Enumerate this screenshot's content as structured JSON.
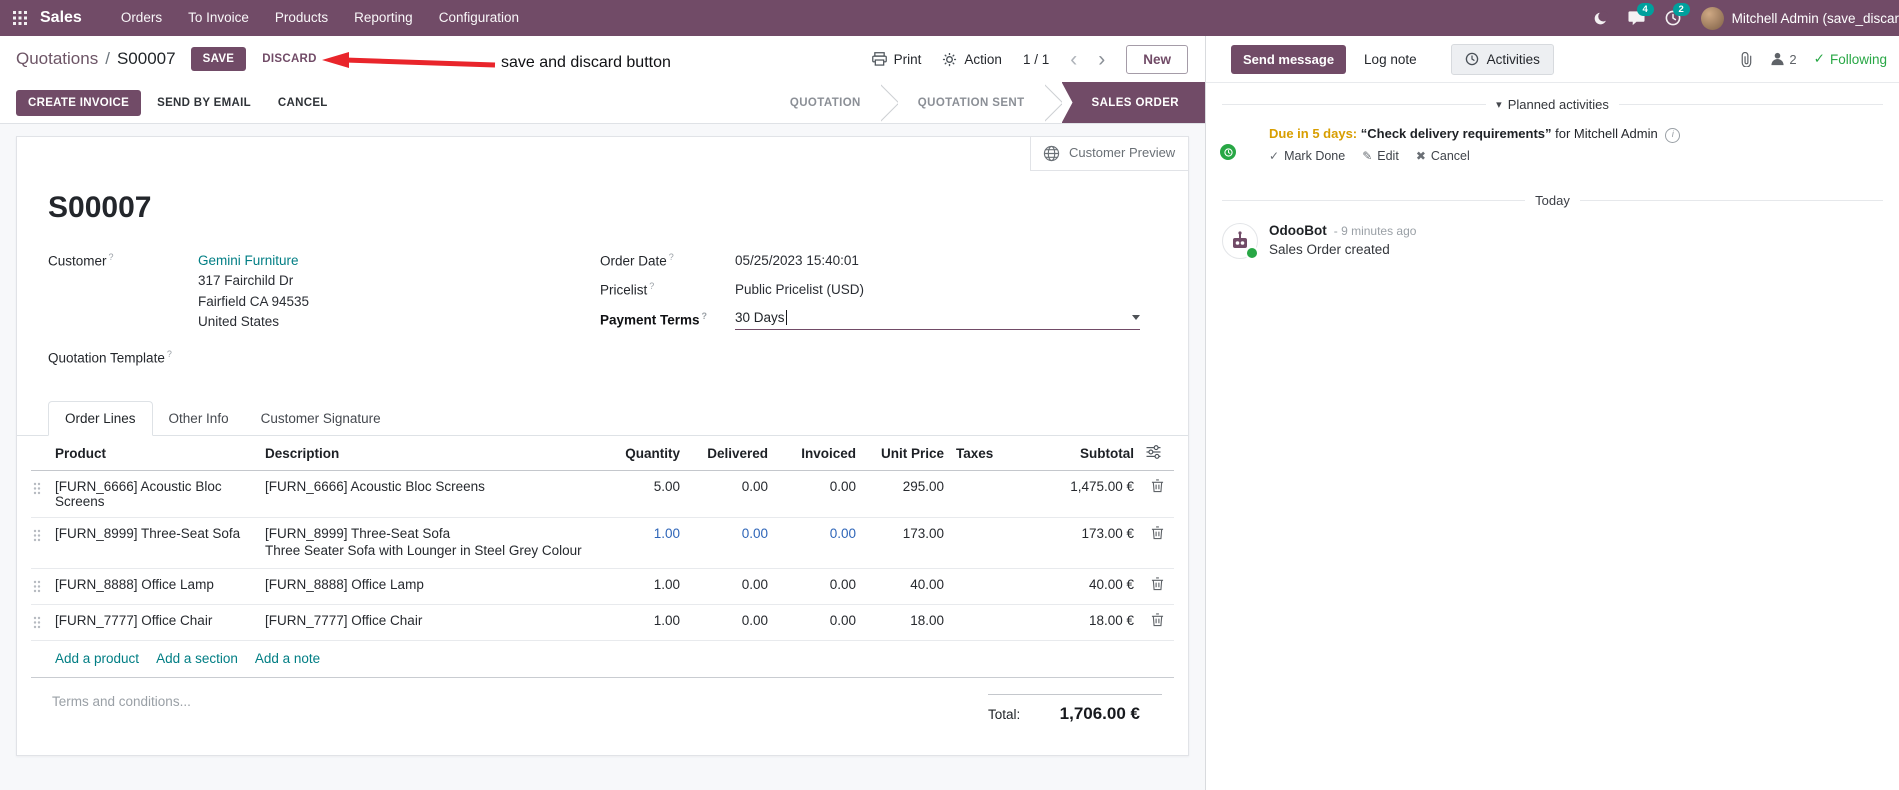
{
  "colors": {
    "brand": "#714B67",
    "link": "#017E84",
    "badge": "#00A09D",
    "success": "#28a745",
    "due_warning": "#D89E00",
    "highlight_cell": "#2E65B8",
    "annotation_red": "#E9252B",
    "active_stage_bg": "#714B67"
  },
  "icons": {
    "caret_down": "▾",
    "chevron_left": "‹",
    "chevron_right": "›",
    "check": "✓",
    "pencil": "✎",
    "cross": "✖",
    "info": "i",
    "question": "?"
  },
  "topbar": {
    "app": "Sales",
    "menus": [
      "Orders",
      "To Invoice",
      "Products",
      "Reporting",
      "Configuration"
    ],
    "messages_badge": "4",
    "activities_badge": "2",
    "user_name": "Mitchell Admin (save_discar"
  },
  "control_panel": {
    "breadcrumb_parent": "Quotations",
    "breadcrumb_sep": "/",
    "breadcrumb_current": "S00007",
    "save": "SAVE",
    "discard": "DISCARD",
    "print": "Print",
    "action": "Action",
    "pager": "1 / 1",
    "new": "New"
  },
  "annotation": {
    "label": "save and discard button"
  },
  "statusbar": {
    "create_invoice": "CREATE INVOICE",
    "send_by_email": "SEND BY EMAIL",
    "cancel": "CANCEL",
    "stages": [
      {
        "label": "QUOTATION"
      },
      {
        "label": "QUOTATION SENT"
      },
      {
        "label": "SALES ORDER"
      }
    ]
  },
  "form": {
    "customer_preview": "Customer Preview",
    "title": "S00007",
    "fields": {
      "customer_label": "Customer",
      "customer_name": "Gemini Furniture",
      "address_line1": "317 Fairchild Dr",
      "address_line2": "Fairfield CA 94535",
      "address_line3": "United States",
      "quotation_template_label": "Quotation Template",
      "order_date_label": "Order Date",
      "order_date_value": "05/25/2023 15:40:01",
      "pricelist_label": "Pricelist",
      "pricelist_value": "Public Pricelist (USD)",
      "payment_terms_label": "Payment Terms",
      "payment_terms_value": "30 Days"
    },
    "tabs": [
      {
        "label": "Order Lines"
      },
      {
        "label": "Other Info"
      },
      {
        "label": "Customer Signature"
      }
    ],
    "table": {
      "headers": [
        "Product",
        "Description",
        "Quantity",
        "Delivered",
        "Invoiced",
        "Unit Price",
        "Taxes",
        "Subtotal"
      ],
      "rows": [
        {
          "product": "[FURN_6666] Acoustic Bloc Screens",
          "description": "[FURN_6666] Acoustic Bloc Screens",
          "description2": "",
          "quantity": "5.00",
          "delivered": "0.00",
          "invoiced": "0.00",
          "unit_price": "295.00",
          "taxes": "",
          "subtotal": "1,475.00 €"
        },
        {
          "product": "[FURN_8999] Three-Seat Sofa",
          "description": "[FURN_8999] Three-Seat Sofa",
          "description2": "Three Seater Sofa with Lounger in Steel Grey Colour",
          "quantity": "1.00",
          "delivered": "0.00",
          "invoiced": "0.00",
          "unit_price": "173.00",
          "taxes": "",
          "subtotal": "173.00 €"
        },
        {
          "product": "[FURN_8888] Office Lamp",
          "description": "[FURN_8888] Office Lamp",
          "description2": "",
          "quantity": "1.00",
          "delivered": "0.00",
          "invoiced": "0.00",
          "unit_price": "40.00",
          "taxes": "",
          "subtotal": "40.00 €"
        },
        {
          "product": "[FURN_7777] Office Chair",
          "description": "[FURN_7777] Office Chair",
          "description2": "",
          "quantity": "1.00",
          "delivered": "0.00",
          "invoiced": "0.00",
          "unit_price": "18.00",
          "taxes": "",
          "subtotal": "18.00 €"
        }
      ]
    },
    "add_product": "Add a product",
    "add_section": "Add a section",
    "add_note": "Add a note",
    "terms_placeholder": "Terms and conditions...",
    "total_label": "Total:",
    "total_value": "1,706.00 €"
  },
  "chatter": {
    "send_message": "Send message",
    "log_note": "Log note",
    "activities": "Activities",
    "followers_count": "2",
    "following": "Following",
    "planned_activities": "Planned activities",
    "activity": {
      "due": "Due in 5 days:",
      "summary": "“Check delivery requirements”",
      "assignee": "for Mitchell Admin",
      "mark_done": "Mark Done",
      "edit": "Edit",
      "cancel": "Cancel"
    },
    "day_divider": "Today",
    "message": {
      "author": "OdooBot",
      "timestamp": "- 9 minutes ago",
      "body": "Sales Order created"
    }
  }
}
